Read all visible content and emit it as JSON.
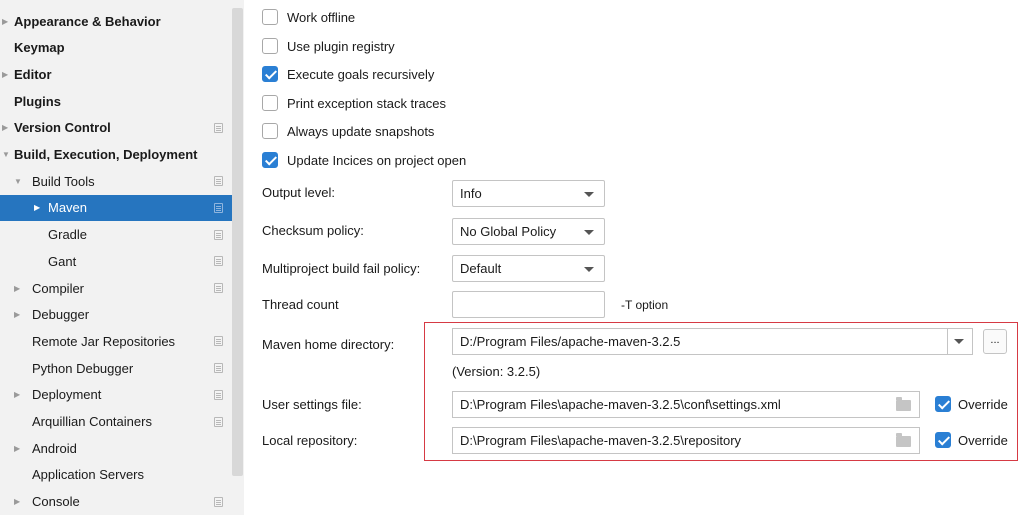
{
  "sidebar": {
    "items": [
      {
        "label": "Appearance & Behavior",
        "bold": true,
        "arrow": "right"
      },
      {
        "label": "Keymap",
        "bold": true
      },
      {
        "label": "Editor",
        "bold": true,
        "arrow": "right"
      },
      {
        "label": "Plugins",
        "bold": true
      },
      {
        "label": "Version Control",
        "bold": true,
        "arrow": "right",
        "proj": true
      },
      {
        "label": "Build, Execution, Deployment",
        "bold": true,
        "arrow": "down"
      },
      {
        "label": "Build Tools",
        "arrow": "down",
        "proj": true
      },
      {
        "label": "Maven",
        "arrow": "right",
        "proj": true,
        "selected": true
      },
      {
        "label": "Gradle",
        "proj": true
      },
      {
        "label": "Gant",
        "proj": true
      },
      {
        "label": "Compiler",
        "arrow": "right",
        "proj": true
      },
      {
        "label": "Debugger",
        "arrow": "right"
      },
      {
        "label": "Remote Jar Repositories",
        "proj": true
      },
      {
        "label": "Python Debugger",
        "proj": true
      },
      {
        "label": "Deployment",
        "arrow": "right",
        "proj": true
      },
      {
        "label": "Arquillian Containers",
        "proj": true
      },
      {
        "label": "Android",
        "arrow": "right"
      },
      {
        "label": "Application Servers"
      },
      {
        "label": "Console",
        "arrow": "right",
        "proj": true
      }
    ]
  },
  "checkboxes": [
    {
      "label": "Work offline",
      "checked": false
    },
    {
      "label": "Use plugin registry",
      "checked": false
    },
    {
      "label": "Execute goals recursively",
      "checked": true
    },
    {
      "label": "Print exception stack traces",
      "checked": false
    },
    {
      "label": "Always update snapshots",
      "checked": false
    },
    {
      "label": "Update Incices on project open",
      "checked": true
    }
  ],
  "fields": {
    "output_level": {
      "label": "Output level:",
      "value": "Info"
    },
    "checksum_policy": {
      "label": "Checksum policy:",
      "value": "No Global Policy"
    },
    "multiproject": {
      "label": "Multiproject build fail policy:",
      "value": "Default"
    },
    "thread_count": {
      "label": "Thread count",
      "value": "",
      "hint": "-T option"
    },
    "maven_home": {
      "label": "Maven home directory:",
      "value": "D:/Program Files/apache-maven-3.2.5",
      "browse": "...",
      "version": "(Version: 3.2.5)"
    },
    "user_settings": {
      "label": "User settings file:",
      "value": "D:\\Program Files\\apache-maven-3.2.5\\conf\\settings.xml",
      "override_label": "Override",
      "override_checked": true
    },
    "local_repo": {
      "label": "Local repository:",
      "value": "D:\\Program Files\\apache-maven-3.2.5\\repository",
      "override_label": "Override",
      "override_checked": true
    }
  },
  "colors": {
    "selection": "#2675bf",
    "checkbox_checked": "#2a7fd4",
    "highlight_border": "#d63a44"
  }
}
